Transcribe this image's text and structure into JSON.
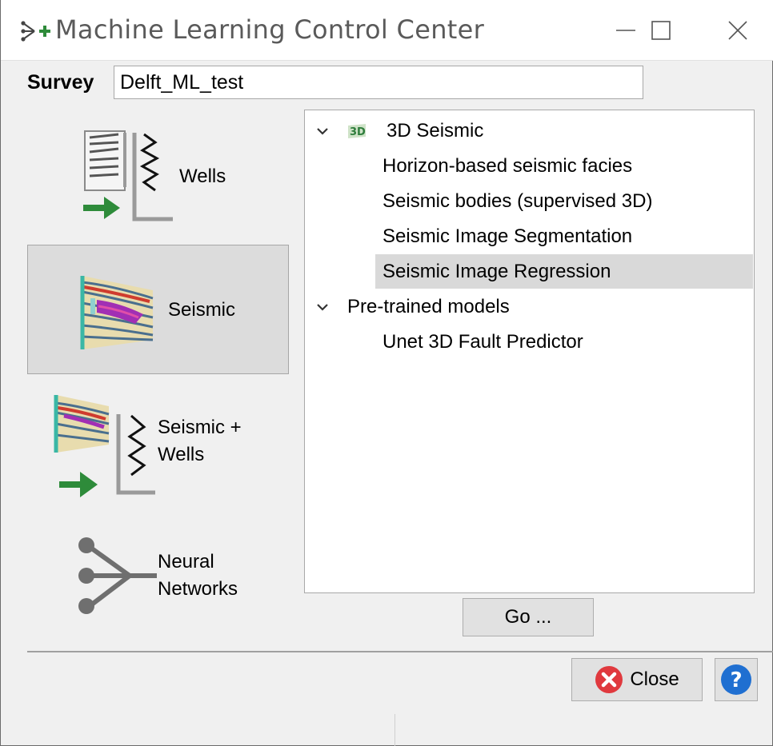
{
  "window": {
    "title": "Machine Learning Control Center",
    "controls": {
      "minimize": "minimize-icon",
      "maximize": "maximize-icon",
      "close": "close-icon"
    }
  },
  "survey": {
    "label": "Survey",
    "value": "Delft_ML_test"
  },
  "sidebar": {
    "items": [
      {
        "label": "Wells",
        "icon": "wells-icon",
        "selected": false
      },
      {
        "label": "Seismic",
        "icon": "seismic-icon",
        "selected": true
      },
      {
        "label_line1": "Seismic +",
        "label_line2": "Wells",
        "icon": "seismic-wells-icon",
        "selected": false
      },
      {
        "label_line1": "Neural",
        "label_line2": "Networks",
        "icon": "neural-networks-icon",
        "selected": false
      }
    ]
  },
  "tree": {
    "groups": [
      {
        "label": "3D Seismic",
        "icon": "3d-seismic-icon",
        "expanded": true,
        "children": [
          "Horizon-based seismic facies",
          "Seismic bodies (supervised 3D)",
          "Seismic Image Segmentation",
          "Seismic Image Regression"
        ],
        "selected_child": "Seismic Image Regression"
      },
      {
        "label": "Pre-trained models",
        "expanded": true,
        "children": [
          "Unet 3D Fault Predictor"
        ]
      }
    ]
  },
  "buttons": {
    "go": "Go ...",
    "close": "Close",
    "help_icon": "help-icon"
  },
  "colors": {
    "accent_green": "#2e8b3a",
    "close_red": "#e0393e",
    "help_blue": "#1f6fd1",
    "selection": "#d9d9d9"
  }
}
